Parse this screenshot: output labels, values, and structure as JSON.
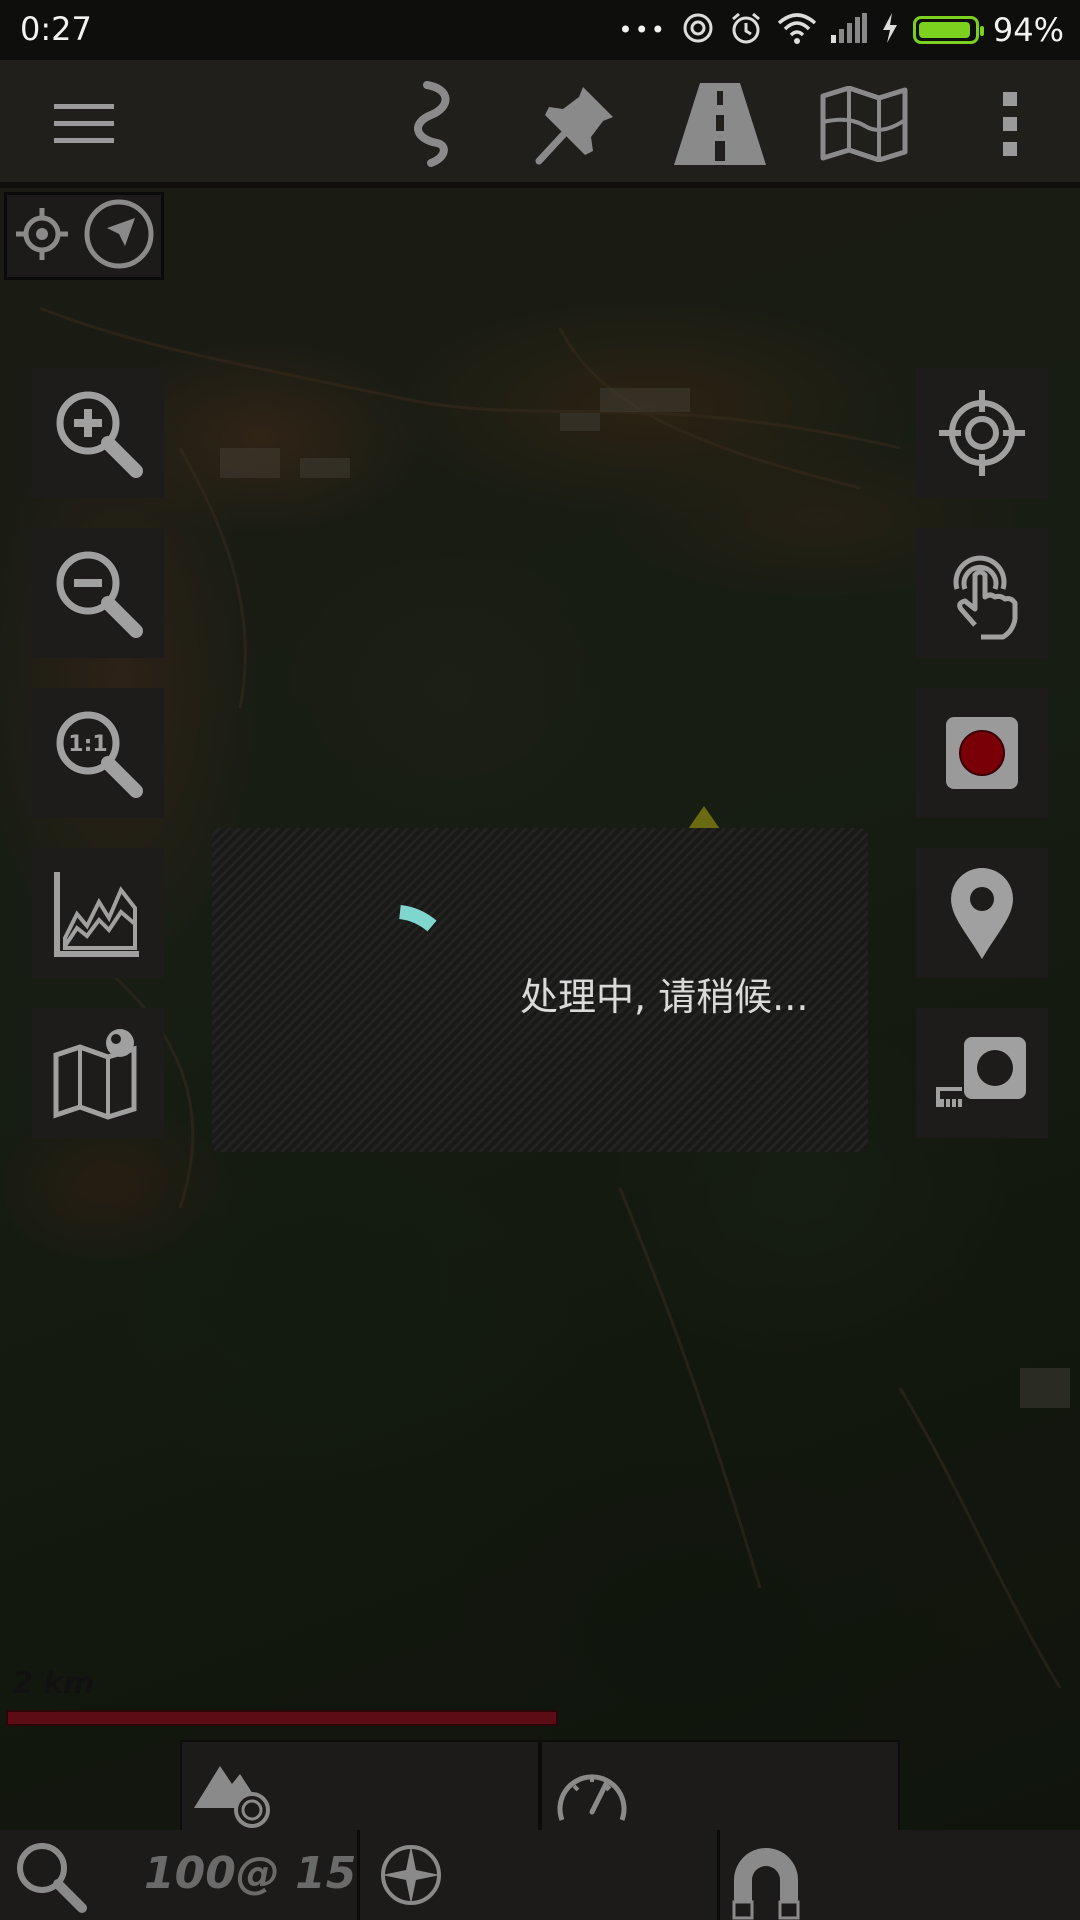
{
  "status_bar": {
    "time": "0:27",
    "dots": "•••",
    "battery_percent": "94%",
    "battery_level": 0.94,
    "battery_color": "#7bd11e"
  },
  "toolbar": {
    "menu_icon": "hamburger-icon",
    "items": [
      "route-icon",
      "pushpin-icon",
      "road-icon",
      "map-icon",
      "overflow-icon"
    ]
  },
  "dialog": {
    "message": "处理中, 请稍候...",
    "spinner_color": "#7fd6cf"
  },
  "map": {
    "scale_label": "2 km",
    "scale_color": "#5b0c14"
  },
  "bottom_bar": {
    "zoom_info": "100@ 15"
  },
  "record_color": "#7a0007"
}
